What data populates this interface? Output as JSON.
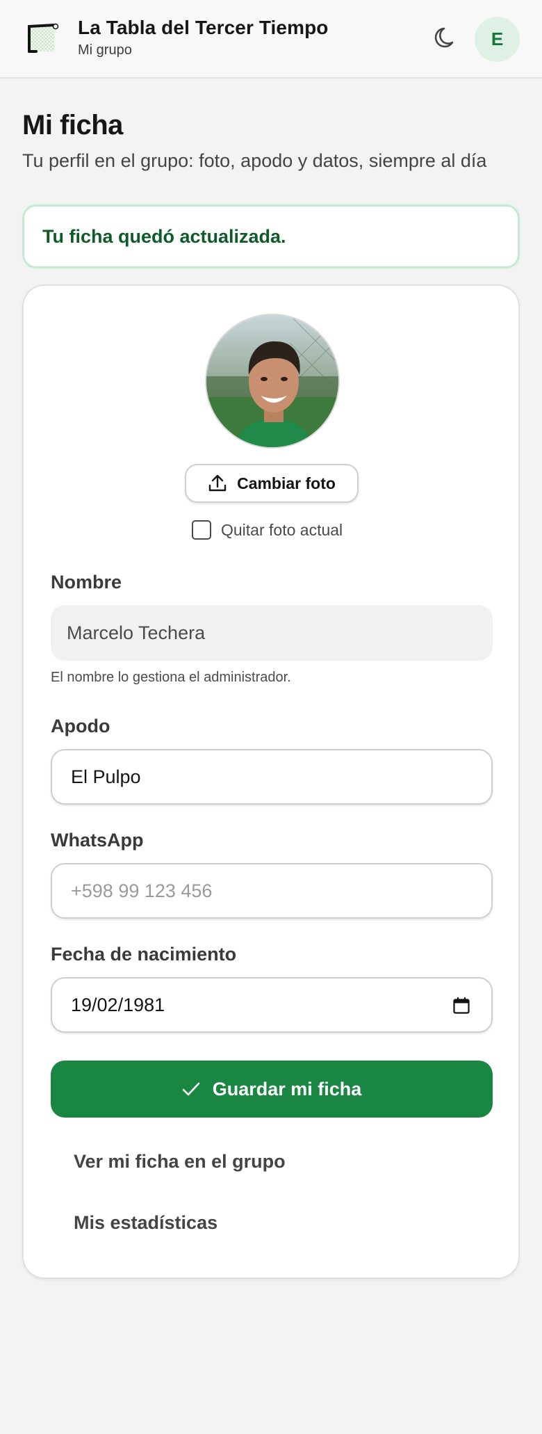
{
  "header": {
    "app_title": "La Tabla del Tercer Tiempo",
    "app_subtitle": "Mi grupo",
    "logo_icon": "goal-net-icon",
    "theme_icon": "moon-icon",
    "avatar_initial": "E"
  },
  "page": {
    "title": "Mi ficha",
    "subtitle": "Tu perfil en el grupo: foto, apodo y datos, siempre al día"
  },
  "alert": {
    "message": "Tu ficha quedó actualizada.",
    "color": "#0f5a29"
  },
  "profile": {
    "photo_icon": "profile-photo",
    "change_photo_label": "Cambiar foto",
    "change_photo_icon": "upload-icon",
    "remove_photo_label": "Quitar foto actual",
    "remove_photo_checked": false
  },
  "form": {
    "name_label": "Nombre",
    "name_value": "Marcelo Techera",
    "name_hint": "El nombre lo gestiona el administrador.",
    "nickname_label": "Apodo",
    "nickname_value": "El Pulpo",
    "whatsapp_label": "WhatsApp",
    "whatsapp_value": "",
    "whatsapp_placeholder": "+598 99 123 456",
    "birthdate_label": "Fecha de nacimiento",
    "birthdate_value": "19/02/1981",
    "save_label": "Guardar mi ficha",
    "save_color": "#198741"
  },
  "links": {
    "view_profile": "Ver mi ficha en el grupo",
    "stats": "Mis estadísticas"
  }
}
